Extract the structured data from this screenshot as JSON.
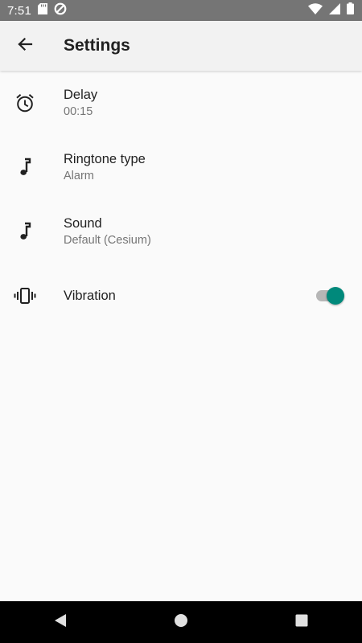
{
  "status_bar": {
    "time": "7:51",
    "left_icons": [
      "sd-card-icon",
      "data-saver-icon"
    ],
    "right_icons": [
      "wifi-icon",
      "signal-icon",
      "battery-icon"
    ]
  },
  "app_bar": {
    "title": "Settings",
    "back_icon": "arrow-back-icon"
  },
  "settings": [
    {
      "id": "delay",
      "icon": "alarm-clock-icon",
      "title": "Delay",
      "subtitle": "00:15"
    },
    {
      "id": "ringtone-type",
      "icon": "music-note-icon",
      "title": "Ringtone type",
      "subtitle": "Alarm"
    },
    {
      "id": "sound",
      "icon": "music-note-icon",
      "title": "Sound",
      "subtitle": "Default (Cesium)"
    },
    {
      "id": "vibration",
      "icon": "vibration-icon",
      "title": "Vibration",
      "toggle_on": true
    }
  ],
  "nav_bar": {
    "buttons": [
      "back-triangle-icon",
      "home-circle-icon",
      "recents-square-icon"
    ]
  },
  "colors": {
    "accent": "#00897b",
    "status_bar": "#757575",
    "app_bar": "#f2f2f2",
    "background": "#fafafa",
    "nav_bar": "#000000"
  }
}
